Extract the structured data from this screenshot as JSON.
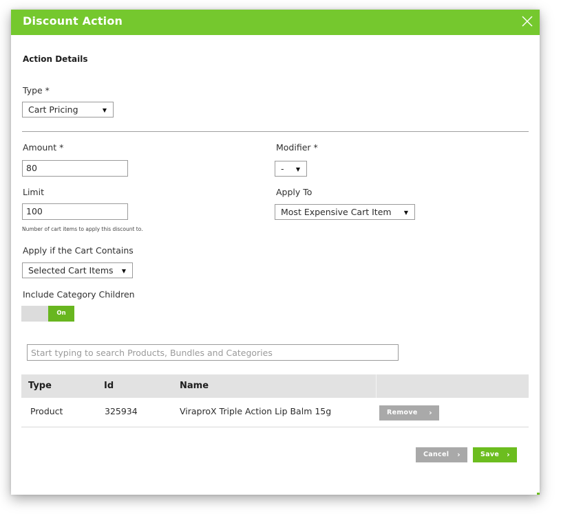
{
  "modal": {
    "title": "Discount Action",
    "close_icon": "close-icon",
    "section_title": "Action Details"
  },
  "form": {
    "type": {
      "label": "Type *",
      "value": "Cart Pricing"
    },
    "amount": {
      "label": "Amount *",
      "value": "80"
    },
    "modifier": {
      "label": "Modifier *",
      "value": "-"
    },
    "limit": {
      "label": "Limit",
      "value": "100",
      "hint": "Number of cart items to apply this discount to."
    },
    "apply_to": {
      "label": "Apply To",
      "value": "Most Expensive Cart Item"
    },
    "cart_contains": {
      "label": "Apply if the Cart Contains",
      "value": "Selected Cart Items"
    },
    "include_children": {
      "label": "Include Category Children",
      "toggle_label": "On",
      "state": "on"
    }
  },
  "search": {
    "placeholder": "Start typing to search Products, Bundles and Categories"
  },
  "table": {
    "headers": [
      "Type",
      "Id",
      "Name",
      ""
    ],
    "rows": [
      {
        "type": "Product",
        "id": "325934",
        "name": "ViraproX Triple Action Lip Balm 15g",
        "action": "Remove"
      }
    ]
  },
  "footer": {
    "cancel_label": "Cancel",
    "save_label": "Save"
  },
  "colors": {
    "accent": "#75c82e",
    "button_green": "#6cbd1f",
    "button_grey": "#a9a9a9"
  },
  "icons": {
    "select_caret": "▼",
    "button_chevron": "›"
  }
}
